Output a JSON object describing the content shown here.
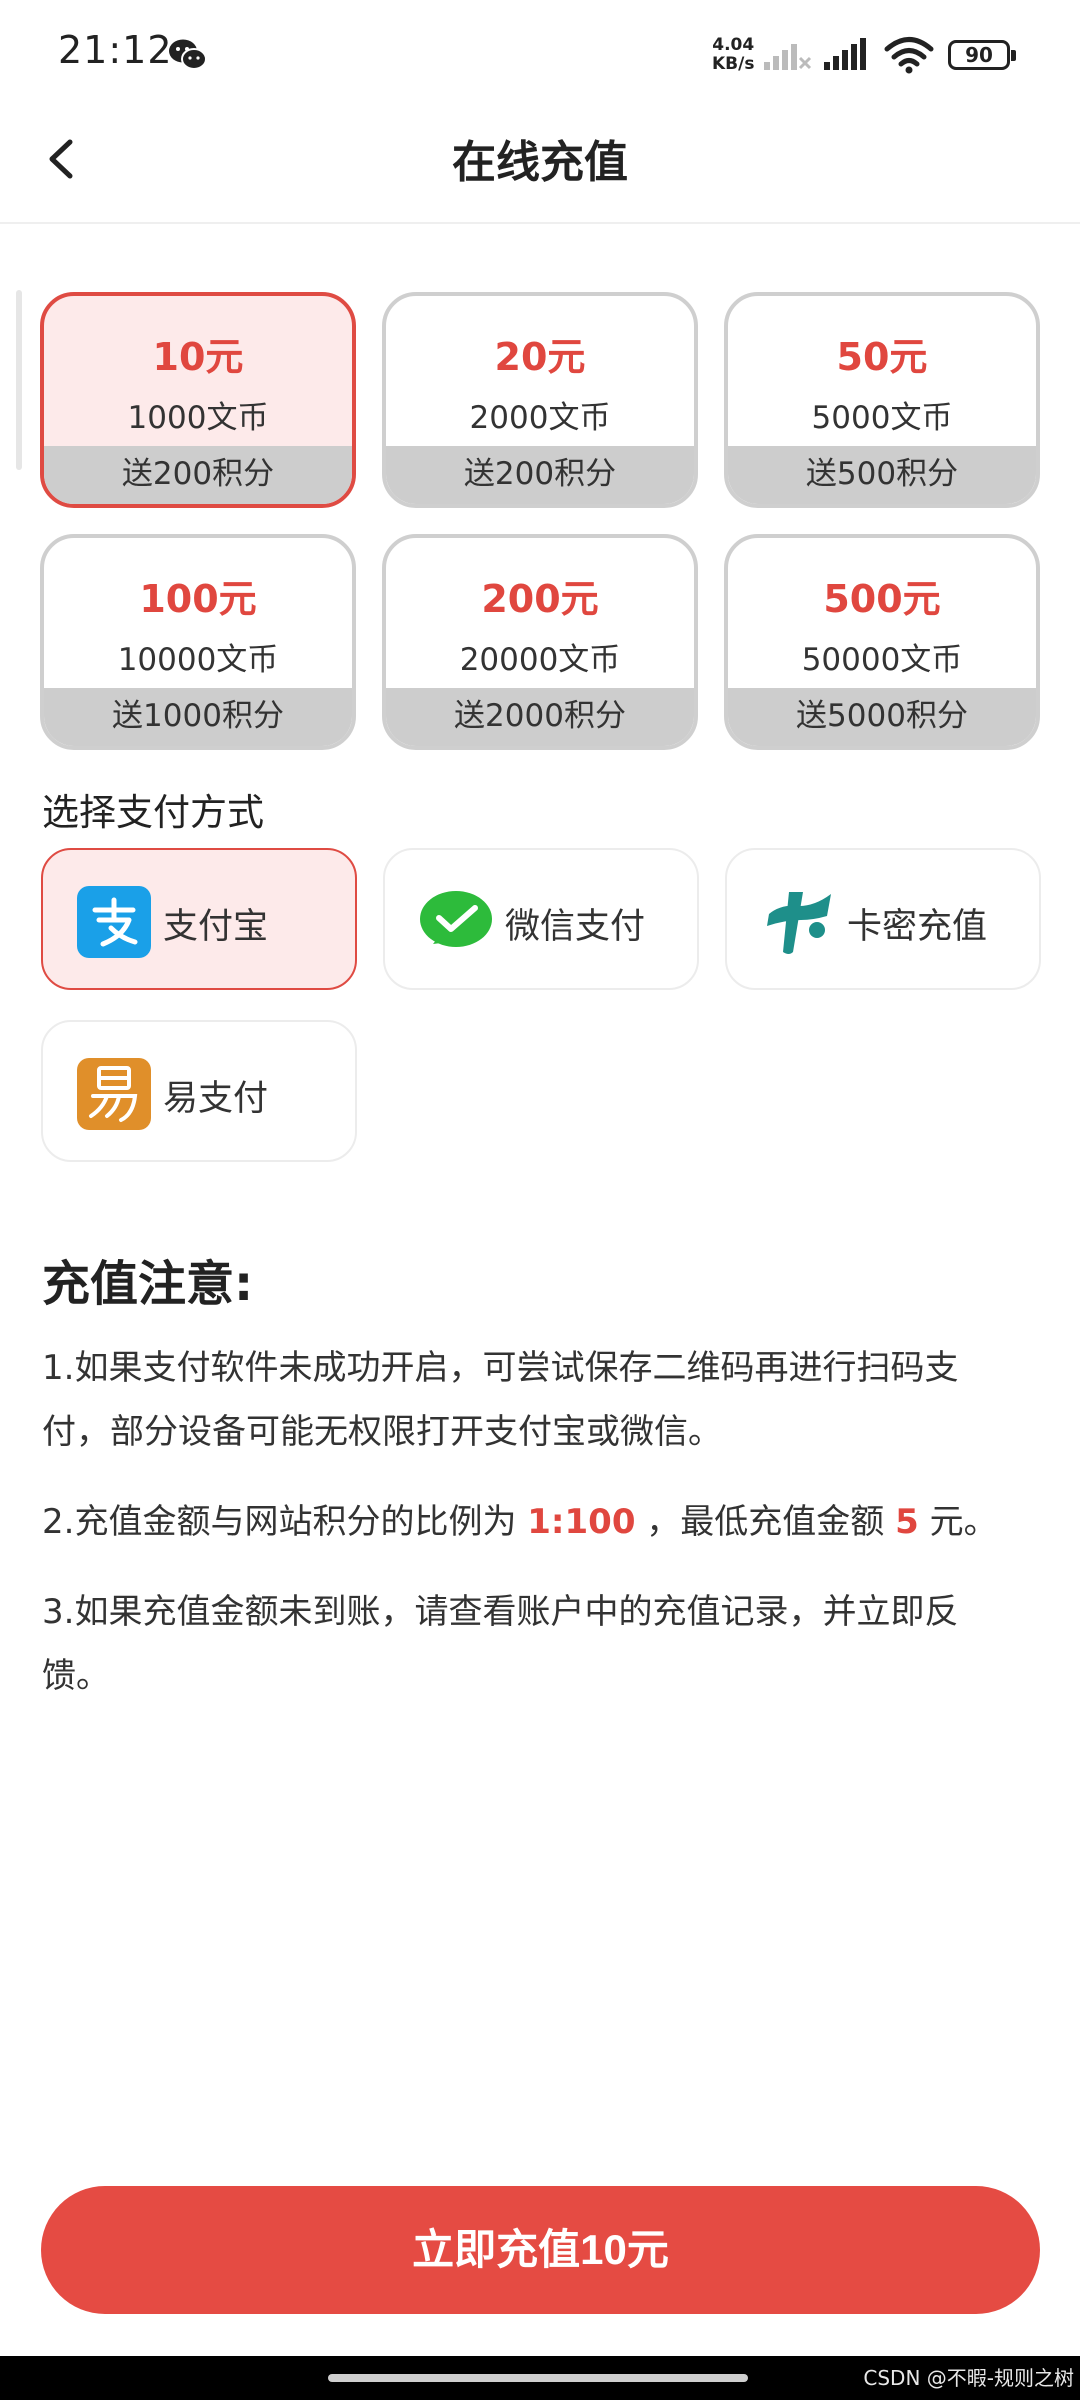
{
  "status_bar": {
    "time": "21:12",
    "net_speed_value": "4.04",
    "net_speed_unit": "KB/s",
    "battery": "90"
  },
  "nav": {
    "title": "在线充值"
  },
  "packages": [
    {
      "price": "10元",
      "coins": "1000文币",
      "bonus": "送200积分",
      "selected": true
    },
    {
      "price": "20元",
      "coins": "2000文币",
      "bonus": "送200积分",
      "selected": false
    },
    {
      "price": "50元",
      "coins": "5000文币",
      "bonus": "送500积分",
      "selected": false
    },
    {
      "price": "100元",
      "coins": "10000文币",
      "bonus": "送1000积分",
      "selected": false
    },
    {
      "price": "200元",
      "coins": "20000文币",
      "bonus": "送2000积分",
      "selected": false
    },
    {
      "price": "500元",
      "coins": "50000文币",
      "bonus": "送5000积分",
      "selected": false
    }
  ],
  "payment": {
    "label": "选择支付方式",
    "methods": [
      {
        "label": "支付宝",
        "icon": "alipay-icon",
        "selected": true
      },
      {
        "label": "微信支付",
        "icon": "wechat-pay-icon",
        "selected": false
      },
      {
        "label": "卡密充值",
        "icon": "card-key-icon",
        "selected": false
      },
      {
        "label": "易支付",
        "icon": "epay-icon",
        "selected": false
      }
    ]
  },
  "notes": {
    "title": "充值注意:",
    "note1": "1.如果支付软件未成功开启，可尝试保存二维码再进行扫码支付，部分设备可能无权限打开支付宝或微信。",
    "note2_prefix": "2.充值金额与网站积分的比例为 ",
    "note2_ratio": "1:100",
    "note2_middle": " ，最低充值金额 ",
    "note2_min": "5",
    "note2_suffix": " 元。",
    "note3": "3.如果充值金额未到账，请查看账户中的充值记录，并立即反馈。"
  },
  "submit": {
    "label": "立即充值10元"
  },
  "watermark": "CSDN @不暇-规则之树",
  "colors": {
    "accent": "#e54b43",
    "selected_bg": "#fdeaea",
    "bonus_bg": "#cdcdcd"
  }
}
